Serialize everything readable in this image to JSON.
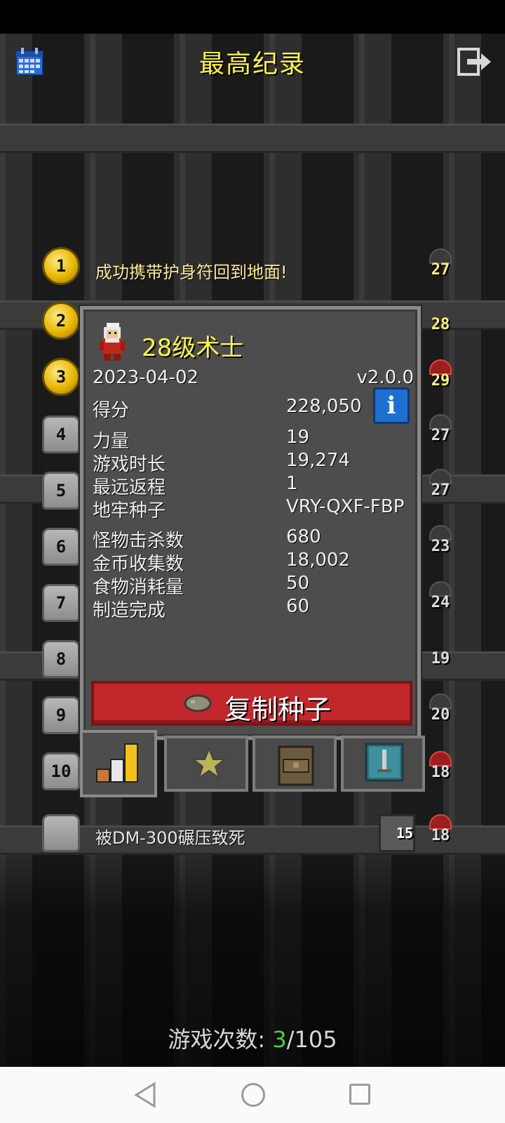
{
  "header": {
    "title": "最高纪录",
    "left_icon": "calendar-icon",
    "right_icon": "exit-icon"
  },
  "entries": [
    {
      "rank": "1",
      "text": "成功携带护身符回到地面!",
      "depth": "27"
    },
    {
      "rank": "2",
      "depth": "28"
    },
    {
      "rank": "3",
      "depth": "29"
    },
    {
      "rank": "4",
      "depth": "27"
    },
    {
      "rank": "5",
      "depth": "27"
    },
    {
      "rank": "6",
      "depth": "23"
    },
    {
      "rank": "7",
      "depth": "24"
    },
    {
      "rank": "8",
      "depth": "19"
    },
    {
      "rank": "9",
      "depth": "20"
    },
    {
      "rank": "10",
      "depth": "18"
    }
  ],
  "last_entry": {
    "text": "被DM-300碾压致死",
    "floor": "15",
    "depth": "18"
  },
  "panel": {
    "hero_title": "28级术士",
    "date": "2023-04-02",
    "version": "v2.0.0",
    "score_label": "得分",
    "score_value": "228,050",
    "stats": [
      {
        "label": "力量",
        "value": "19"
      },
      {
        "label": "游戏时长",
        "value": "19,274"
      },
      {
        "label": "最远返程",
        "value": "1"
      },
      {
        "label": "地牢种子",
        "value": "VRY-QXF-FBP"
      }
    ],
    "stats2": [
      {
        "label": "怪物击杀数",
        "value": "680"
      },
      {
        "label": "金币收集数",
        "value": "18,002"
      },
      {
        "label": "食物消耗量",
        "value": "50"
      },
      {
        "label": "制造完成",
        "value": "60"
      }
    ],
    "copy_seed_label": "复制种子",
    "tabs": [
      "stats-icon",
      "badges-icon",
      "items-icon",
      "talents-icon"
    ]
  },
  "footer": {
    "games_label": "游戏次数: ",
    "games_current": "3",
    "games_total": "/105"
  },
  "colors": {
    "title": "#fff44a",
    "copy_button": "#c0282b",
    "info_button": "#1f6fd0"
  }
}
